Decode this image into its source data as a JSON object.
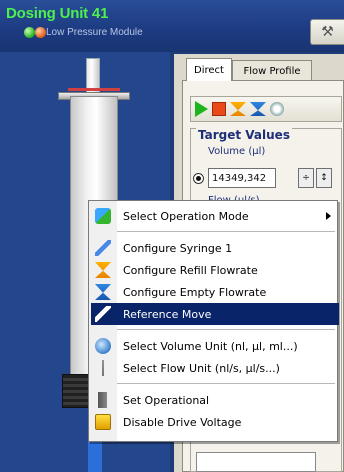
{
  "header": {
    "title": "Dosing Unit 41",
    "subtitle": "Low Pressure Module",
    "status_led_green": "#22b01f",
    "status_led_orange": "#e05818"
  },
  "tabs": [
    {
      "label": "Direct"
    },
    {
      "label": "Flow Profile"
    }
  ],
  "toolbar": {
    "icons": [
      "play-icon",
      "stop-icon",
      "refill-icon",
      "empty-icon",
      "reference-icon"
    ]
  },
  "target_values": {
    "title": "Target Values",
    "volume_label": "Volume (µl)",
    "volume_value": "14349,342",
    "flow_label": "Flow (µl/s)"
  },
  "context_menu": {
    "items": [
      {
        "label": "Select Operation Mode",
        "icon": "operation-mode-icon",
        "has_submenu": true
      },
      {
        "label": "Configure Syringe 1",
        "icon": "syringe-icon"
      },
      {
        "label": "Configure Refill Flowrate",
        "icon": "refill-flowrate-icon"
      },
      {
        "label": "Configure Empty Flowrate",
        "icon": "empty-flowrate-icon"
      },
      {
        "label": "Reference Move",
        "icon": "reference-move-icon",
        "selected": true
      },
      {
        "label": "Select Volume Unit (nl, µl, ml...)",
        "icon": "volume-unit-icon"
      },
      {
        "label": "Select Flow Unit (nl/s, µl/s...)",
        "icon": "flow-unit-icon"
      },
      {
        "label": "Set Operational",
        "icon": "set-operational-icon"
      },
      {
        "label": "Disable Drive Voltage",
        "icon": "drive-voltage-icon"
      }
    ]
  },
  "colors": {
    "title_green": "#4df04d",
    "menu_highlight": "#0a246a",
    "panel_bg": "#dcd9cc",
    "app_bg": "#1e3c78"
  }
}
